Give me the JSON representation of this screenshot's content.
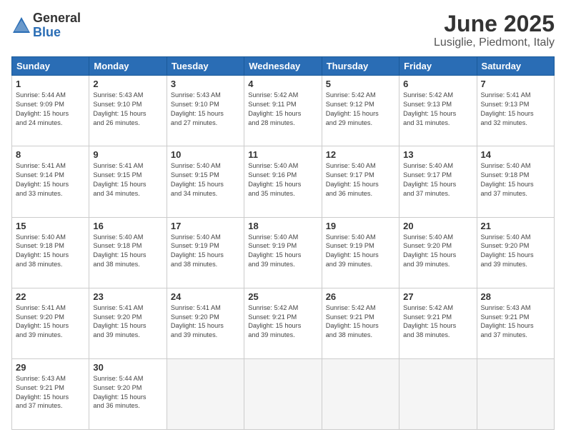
{
  "logo": {
    "general": "General",
    "blue": "Blue"
  },
  "title": "June 2025",
  "subtitle": "Lusiglie, Piedmont, Italy",
  "days_header": [
    "Sunday",
    "Monday",
    "Tuesday",
    "Wednesday",
    "Thursday",
    "Friday",
    "Saturday"
  ],
  "weeks": [
    [
      {
        "num": "1",
        "rise": "5:44 AM",
        "set": "9:09 PM",
        "daylight": "15 hours and 24 minutes."
      },
      {
        "num": "2",
        "rise": "5:43 AM",
        "set": "9:10 PM",
        "daylight": "15 hours and 26 minutes."
      },
      {
        "num": "3",
        "rise": "5:43 AM",
        "set": "9:10 PM",
        "daylight": "15 hours and 27 minutes."
      },
      {
        "num": "4",
        "rise": "5:42 AM",
        "set": "9:11 PM",
        "daylight": "15 hours and 28 minutes."
      },
      {
        "num": "5",
        "rise": "5:42 AM",
        "set": "9:12 PM",
        "daylight": "15 hours and 29 minutes."
      },
      {
        "num": "6",
        "rise": "5:42 AM",
        "set": "9:13 PM",
        "daylight": "15 hours and 31 minutes."
      },
      {
        "num": "7",
        "rise": "5:41 AM",
        "set": "9:13 PM",
        "daylight": "15 hours and 32 minutes."
      }
    ],
    [
      {
        "num": "8",
        "rise": "5:41 AM",
        "set": "9:14 PM",
        "daylight": "15 hours and 33 minutes."
      },
      {
        "num": "9",
        "rise": "5:41 AM",
        "set": "9:15 PM",
        "daylight": "15 hours and 34 minutes."
      },
      {
        "num": "10",
        "rise": "5:40 AM",
        "set": "9:15 PM",
        "daylight": "15 hours and 34 minutes."
      },
      {
        "num": "11",
        "rise": "5:40 AM",
        "set": "9:16 PM",
        "daylight": "15 hours and 35 minutes."
      },
      {
        "num": "12",
        "rise": "5:40 AM",
        "set": "9:17 PM",
        "daylight": "15 hours and 36 minutes."
      },
      {
        "num": "13",
        "rise": "5:40 AM",
        "set": "9:17 PM",
        "daylight": "15 hours and 37 minutes."
      },
      {
        "num": "14",
        "rise": "5:40 AM",
        "set": "9:18 PM",
        "daylight": "15 hours and 37 minutes."
      }
    ],
    [
      {
        "num": "15",
        "rise": "5:40 AM",
        "set": "9:18 PM",
        "daylight": "15 hours and 38 minutes."
      },
      {
        "num": "16",
        "rise": "5:40 AM",
        "set": "9:18 PM",
        "daylight": "15 hours and 38 minutes."
      },
      {
        "num": "17",
        "rise": "5:40 AM",
        "set": "9:19 PM",
        "daylight": "15 hours and 38 minutes."
      },
      {
        "num": "18",
        "rise": "5:40 AM",
        "set": "9:19 PM",
        "daylight": "15 hours and 39 minutes."
      },
      {
        "num": "19",
        "rise": "5:40 AM",
        "set": "9:19 PM",
        "daylight": "15 hours and 39 minutes."
      },
      {
        "num": "20",
        "rise": "5:40 AM",
        "set": "9:20 PM",
        "daylight": "15 hours and 39 minutes."
      },
      {
        "num": "21",
        "rise": "5:40 AM",
        "set": "9:20 PM",
        "daylight": "15 hours and 39 minutes."
      }
    ],
    [
      {
        "num": "22",
        "rise": "5:41 AM",
        "set": "9:20 PM",
        "daylight": "15 hours and 39 minutes."
      },
      {
        "num": "23",
        "rise": "5:41 AM",
        "set": "9:20 PM",
        "daylight": "15 hours and 39 minutes."
      },
      {
        "num": "24",
        "rise": "5:41 AM",
        "set": "9:20 PM",
        "daylight": "15 hours and 39 minutes."
      },
      {
        "num": "25",
        "rise": "5:42 AM",
        "set": "9:21 PM",
        "daylight": "15 hours and 39 minutes."
      },
      {
        "num": "26",
        "rise": "5:42 AM",
        "set": "9:21 PM",
        "daylight": "15 hours and 38 minutes."
      },
      {
        "num": "27",
        "rise": "5:42 AM",
        "set": "9:21 PM",
        "daylight": "15 hours and 38 minutes."
      },
      {
        "num": "28",
        "rise": "5:43 AM",
        "set": "9:21 PM",
        "daylight": "15 hours and 37 minutes."
      }
    ],
    [
      {
        "num": "29",
        "rise": "5:43 AM",
        "set": "9:21 PM",
        "daylight": "15 hours and 37 minutes."
      },
      {
        "num": "30",
        "rise": "5:44 AM",
        "set": "9:20 PM",
        "daylight": "15 hours and 36 minutes."
      },
      null,
      null,
      null,
      null,
      null
    ]
  ],
  "labels": {
    "sunrise": "Sunrise:",
    "sunset": "Sunset:",
    "daylight": "Daylight:"
  }
}
